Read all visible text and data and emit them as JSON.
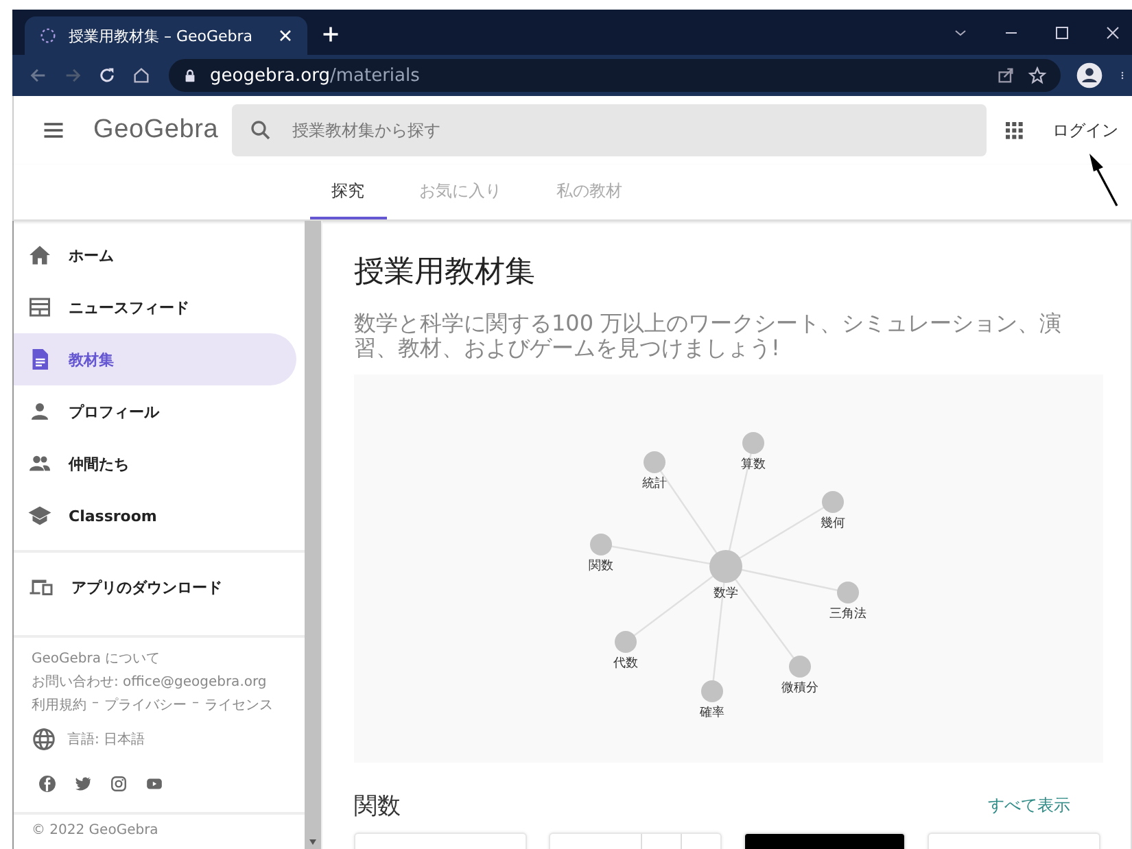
{
  "browser": {
    "tab_title": "授業用教材集 – GeoGebra",
    "url_host": "geogebra.org",
    "url_path": "/materials"
  },
  "header": {
    "logo": "GeoGebra",
    "search": {
      "placeholder": "授業教材集から探す"
    },
    "login": "ログイン"
  },
  "tabs": [
    {
      "label": "探究",
      "selected": true
    },
    {
      "label": "お気に入り",
      "selected": false
    },
    {
      "label": "私の教材",
      "selected": false
    }
  ],
  "sidebar": {
    "items": [
      {
        "label": "ホーム",
        "selected": false
      },
      {
        "label": "ニュースフィード",
        "selected": false
      },
      {
        "label": "教材集",
        "selected": true
      },
      {
        "label": "プロフィール",
        "selected": false
      },
      {
        "label": "仲間たち",
        "selected": false
      },
      {
        "label": "Classroom",
        "selected": false
      }
    ],
    "download": "アプリのダウンロード",
    "footer_links": [
      "GeoGebra について",
      "お問い合わせ: office@geogebra.org"
    ],
    "legal_links": [
      "利用規約",
      "プライバシー",
      "ライセンス"
    ],
    "separator": "–",
    "language": "言語: 日本語",
    "copyright": "© 2022 GeoGebra"
  },
  "main": {
    "title": "授業用教材集",
    "description": "数学と科学に関する100 万以上のワークシート、シミュレーション、演習、教材、およびゲームを見つけましょう!",
    "topic_graph": [
      {
        "label": "数学",
        "kind": "center"
      },
      {
        "label": "統計",
        "kind": "leaf"
      },
      {
        "label": "算数",
        "kind": "leaf"
      },
      {
        "label": "幾何",
        "kind": "leaf"
      },
      {
        "label": "関数",
        "kind": "leaf"
      },
      {
        "label": "三角法",
        "kind": "leaf"
      },
      {
        "label": "代数",
        "kind": "leaf"
      },
      {
        "label": "確率",
        "kind": "leaf"
      },
      {
        "label": "微積分",
        "kind": "leaf"
      }
    ],
    "section": {
      "title": "関数",
      "show_all": "すべて表示",
      "cards": [
        {
          "kind": "plain"
        },
        {
          "kind": "split"
        },
        {
          "kind": "dark"
        },
        {
          "kind": "plain"
        }
      ]
    }
  }
}
